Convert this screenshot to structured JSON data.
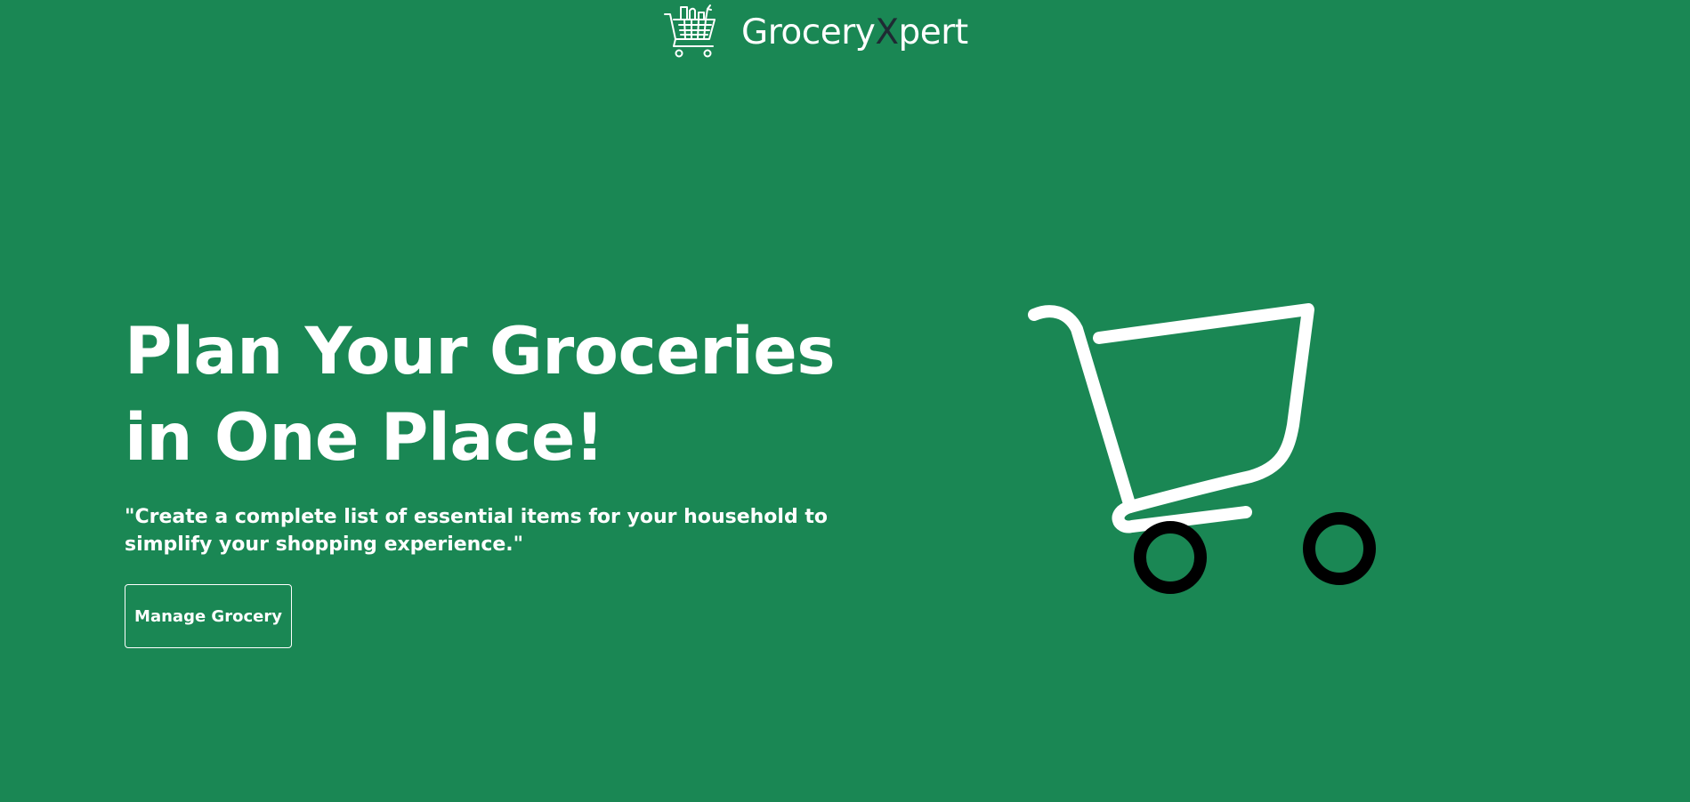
{
  "header": {
    "brand_prefix": "Grocery",
    "brand_accent": "X",
    "brand_suffix": "pert",
    "logo_icon": "grocery-cart-icon"
  },
  "hero": {
    "title_line1": "Plan Your Groceries",
    "title_line2": "in One Place!",
    "subtitle_line1": "\"Create a complete list of essential items for your household to",
    "subtitle_line2": "simplify your shopping experience.\"",
    "cta_label": "Manage Grocery",
    "illustration_icon": "shopping-cart-icon"
  },
  "colors": {
    "background": "#1a8754",
    "text": "#ffffff",
    "brand_accent": "#1f2a33",
    "cart_wheels": "#000000"
  }
}
